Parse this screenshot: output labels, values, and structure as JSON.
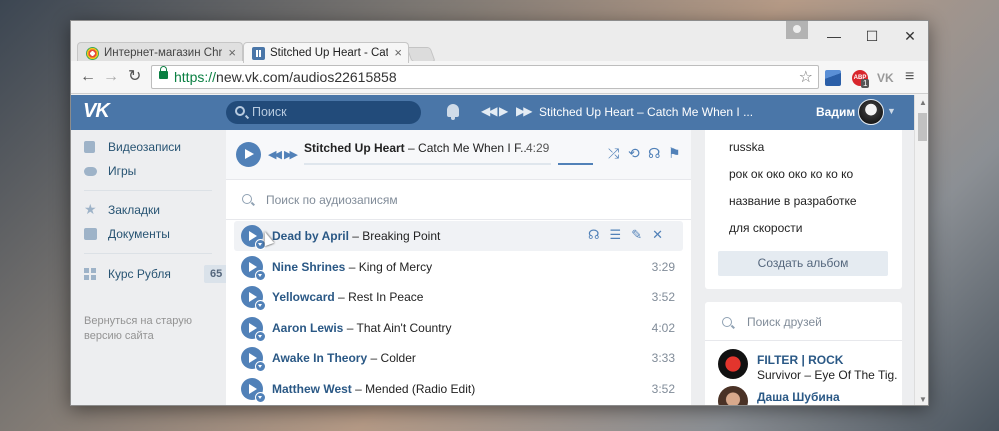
{
  "browser": {
    "tabs": [
      {
        "label": "Интернет-магазин Chrom",
        "close": "×"
      },
      {
        "label": "Stitched Up Heart - Catch",
        "close": "×"
      }
    ],
    "url_scheme": "https://",
    "url_rest": "new.vk.com/audios22615858",
    "window_controls": {
      "minimize": "—",
      "maximize": "☐",
      "close": "✕"
    },
    "nav": {
      "back": "←",
      "forward": "→",
      "reload": "↻"
    },
    "extensions": {
      "abp_label": "ABP",
      "abp_badge": "1",
      "vk_label": "VK"
    },
    "star": "☆",
    "menu": "≡"
  },
  "header": {
    "logo": "VK",
    "search_placeholder": "Поиск",
    "now_playing": "Stitched Up Heart – Catch Me When I ...",
    "user_name": "Вадим",
    "controls": {
      "prev": "◀◀",
      "play": "▶",
      "next": "▶▶"
    }
  },
  "sidebar": {
    "items": [
      {
        "label": "Видеозаписи"
      },
      {
        "label": "Игры"
      },
      {
        "label": "Закладки"
      },
      {
        "label": "Документы"
      },
      {
        "label": "Курс Рубля",
        "badge": "65"
      }
    ],
    "old_version_link": "Вернуться на старую версию сайта"
  },
  "player": {
    "artist": "Stitched Up Heart",
    "title": "– Catch Me When I F...",
    "time": "4:29",
    "prev": "◀◀",
    "next": "▶▶",
    "icons": {
      "shuffle": "⤮",
      "repeat": "⟲",
      "related": "☊",
      "broadcast": "⚑"
    }
  },
  "audio_search": {
    "placeholder": "Поиск по аудиозаписям"
  },
  "tracks": [
    {
      "artist": "Dead by April",
      "dash": "–",
      "title": "Breaking Point",
      "duration": ""
    },
    {
      "artist": "Nine Shrines",
      "dash": "–",
      "title": "King of Mercy",
      "duration": "3:29"
    },
    {
      "artist": "Yellowcard",
      "dash": "–",
      "title": "Rest In Peace",
      "duration": "3:52"
    },
    {
      "artist": "Aaron Lewis",
      "dash": "–",
      "title": "That Ain't Country",
      "duration": "4:02"
    },
    {
      "artist": "Awake In Theory",
      "dash": "–",
      "title": "Colder",
      "duration": "3:33"
    },
    {
      "artist": "Matthew West",
      "dash": "–",
      "title": "Mended (Radio Edit)",
      "duration": "3:52"
    }
  ],
  "row_actions": {
    "related": "☊",
    "add_to_list": "☰",
    "edit": "✎",
    "delete": "✕"
  },
  "albums": {
    "items": [
      {
        "label": "russka"
      },
      {
        "label": "рок ок око око ко ко ко"
      },
      {
        "label": "название в разработке"
      },
      {
        "label": "для скорости"
      }
    ],
    "create_button": "Создать альбом"
  },
  "friends": {
    "search_placeholder": "Поиск друзей",
    "items": [
      {
        "name": "FILTER | ROCK",
        "track": "Survivor – Eye Of The Tig..."
      },
      {
        "name": "Даша Шубина",
        "track": ""
      }
    ]
  }
}
